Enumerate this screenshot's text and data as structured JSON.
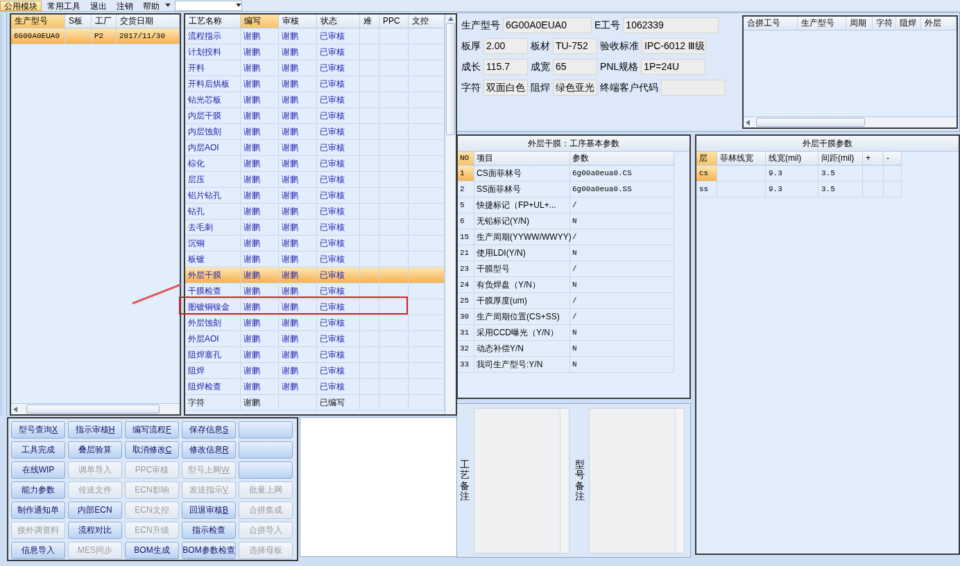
{
  "menu": [
    {
      "label": "公用模块",
      "selected": true
    },
    {
      "label": "常用工具",
      "selected": false
    },
    {
      "label": "退出",
      "selected": false
    },
    {
      "label": "注销",
      "selected": false
    },
    {
      "label": "帮助",
      "selected": false
    }
  ],
  "order_table": {
    "columns": [
      "生产型号",
      "S板",
      "工厂",
      "交货日期"
    ],
    "rows": [
      {
        "cells": [
          "6G00A0EUA0",
          "",
          "P2",
          "2017/11/30"
        ],
        "selected": true
      }
    ]
  },
  "process_table": {
    "columns": [
      {
        "label": "工艺名称",
        "selected": false
      },
      {
        "label": "编写",
        "selected": true
      },
      {
        "label": "审核",
        "selected": false
      },
      {
        "label": "状态",
        "selected": false
      },
      {
        "label": "难",
        "selected": false
      },
      {
        "label": "PPC",
        "selected": false
      },
      {
        "label": "文控",
        "selected": false
      }
    ],
    "rows": [
      {
        "cells": [
          "流程指示",
          "谢鹏",
          "谢鹏",
          "已审核"
        ],
        "kind": "reviewed",
        "selected": false
      },
      {
        "cells": [
          "计划投料",
          "谢鹏",
          "谢鹏",
          "已审核"
        ],
        "kind": "reviewed",
        "selected": false
      },
      {
        "cells": [
          "开料",
          "谢鹏",
          "谢鹏",
          "已审核"
        ],
        "kind": "reviewed",
        "selected": false
      },
      {
        "cells": [
          "开料后烘板",
          "谢鹏",
          "谢鹏",
          "已审核"
        ],
        "kind": "reviewed",
        "selected": false
      },
      {
        "cells": [
          "钻光芯板",
          "谢鹏",
          "谢鹏",
          "已审核"
        ],
        "kind": "reviewed",
        "selected": false
      },
      {
        "cells": [
          "内层干膜",
          "谢鹏",
          "谢鹏",
          "已审核"
        ],
        "kind": "reviewed",
        "selected": false
      },
      {
        "cells": [
          "内层蚀刻",
          "谢鹏",
          "谢鹏",
          "已审核"
        ],
        "kind": "reviewed",
        "selected": false
      },
      {
        "cells": [
          "内层AOI",
          "谢鹏",
          "谢鹏",
          "已审核"
        ],
        "kind": "reviewed",
        "selected": false
      },
      {
        "cells": [
          "棕化",
          "谢鹏",
          "谢鹏",
          "已审核"
        ],
        "kind": "reviewed",
        "selected": false
      },
      {
        "cells": [
          "层压",
          "谢鹏",
          "谢鹏",
          "已审核"
        ],
        "kind": "reviewed",
        "selected": false
      },
      {
        "cells": [
          "铝片钻孔",
          "谢鹏",
          "谢鹏",
          "已审核"
        ],
        "kind": "reviewed",
        "selected": false
      },
      {
        "cells": [
          "钻孔",
          "谢鹏",
          "谢鹏",
          "已审核"
        ],
        "kind": "reviewed",
        "selected": false
      },
      {
        "cells": [
          "去毛刺",
          "谢鹏",
          "谢鹏",
          "已审核"
        ],
        "kind": "reviewed",
        "selected": false
      },
      {
        "cells": [
          "沉铜",
          "谢鹏",
          "谢鹏",
          "已审核"
        ],
        "kind": "reviewed",
        "selected": false
      },
      {
        "cells": [
          "板镀",
          "谢鹏",
          "谢鹏",
          "已审核"
        ],
        "kind": "reviewed",
        "selected": false
      },
      {
        "cells": [
          "外层干膜",
          "谢鹏",
          "谢鹏",
          "已审核"
        ],
        "kind": "reviewed",
        "selected": true
      },
      {
        "cells": [
          "干膜检查",
          "谢鹏",
          "谢鹏",
          "已审核"
        ],
        "kind": "reviewed",
        "selected": false
      },
      {
        "cells": [
          "图镀铜镍金",
          "谢鹏",
          "谢鹏",
          "已审核"
        ],
        "kind": "reviewed",
        "selected": false
      },
      {
        "cells": [
          "外层蚀刻",
          "谢鹏",
          "谢鹏",
          "已审核"
        ],
        "kind": "reviewed",
        "selected": false
      },
      {
        "cells": [
          "外层AOI",
          "谢鹏",
          "谢鹏",
          "已审核"
        ],
        "kind": "reviewed",
        "selected": false
      },
      {
        "cells": [
          "阻焊塞孔",
          "谢鹏",
          "谢鹏",
          "已审核"
        ],
        "kind": "reviewed",
        "selected": false
      },
      {
        "cells": [
          "阻焊",
          "谢鹏",
          "谢鹏",
          "已审核"
        ],
        "kind": "reviewed",
        "selected": false
      },
      {
        "cells": [
          "阻焊检查",
          "谢鹏",
          "谢鹏",
          "已审核"
        ],
        "kind": "reviewed",
        "selected": false
      },
      {
        "cells": [
          "字符",
          "谢鹏",
          "",
          "已编写"
        ],
        "kind": "written",
        "selected": false
      }
    ]
  },
  "buttons": [
    {
      "label": "型号查询",
      "shortcut": "X",
      "disabled": false
    },
    {
      "label": "指示审核",
      "shortcut": "H",
      "disabled": false
    },
    {
      "label": "编写流程",
      "shortcut": "F",
      "disabled": false
    },
    {
      "label": "保存信息",
      "shortcut": "S",
      "disabled": false
    },
    {
      "disabled": false
    },
    {
      "label": "工具完成",
      "disabled": false
    },
    {
      "label": "叠层验算",
      "disabled": false
    },
    {
      "label": "取消修改",
      "shortcut": "C",
      "disabled": false
    },
    {
      "label": "修改信息",
      "shortcut": "R",
      "disabled": false
    },
    {
      "disabled": false
    },
    {
      "label": "在线WIP",
      "disabled": false
    },
    {
      "label": "调单导入",
      "disabled": true
    },
    {
      "label": "PPC审核",
      "disabled": true
    },
    {
      "label": "型号上网",
      "shortcut": "W",
      "disabled": true
    },
    {
      "disabled": false
    },
    {
      "label": "能力参数",
      "disabled": false
    },
    {
      "label": "传送文件",
      "disabled": true
    },
    {
      "label": "ECN影响",
      "disabled": true
    },
    {
      "label": "发送指示",
      "shortcut": "V",
      "disabled": true
    },
    {
      "label": "批量上网",
      "disabled": true
    },
    {
      "label": "制作通知单",
      "disabled": false
    },
    {
      "label": "内部ECN",
      "disabled": false
    },
    {
      "label": "ECN文控",
      "disabled": true
    },
    {
      "label": "回退审核",
      "shortcut": "B",
      "disabled": false
    },
    {
      "label": "合拼集成",
      "disabled": true
    },
    {
      "label": "接外调资料",
      "disabled": true
    },
    {
      "label": "流程对比",
      "disabled": false
    },
    {
      "label": "ECN升级",
      "disabled": true
    },
    {
      "label": "指示检查",
      "disabled": false
    },
    {
      "label": "合拼导入",
      "disabled": true
    },
    {
      "label": "信息导入",
      "disabled": false
    },
    {
      "label": "MES同步",
      "disabled": true
    },
    {
      "label": "BOM生成",
      "disabled": false
    },
    {
      "label": "BOM参数检查",
      "disabled": false
    },
    {
      "label": "选择母板",
      "disabled": true
    }
  ],
  "info_form": [
    [
      {
        "label": "生产型号",
        "value": "6G00A0EUA0"
      },
      {
        "label": "E工号",
        "value": "1062339"
      }
    ],
    [
      {
        "label": "板厚",
        "value": "2.00"
      },
      {
        "label": "板材",
        "value": "TU-752"
      },
      {
        "label": "验收标准",
        "value": "IPC-6012 Ⅲ级"
      }
    ],
    [
      {
        "label": "成长",
        "value": "115.7"
      },
      {
        "label": "成宽",
        "value": "65"
      },
      {
        "label": "PNL规格",
        "value": "1P=24U"
      }
    ],
    [
      {
        "label": "字符",
        "value": "双面白色"
      },
      {
        "label": "阻焊",
        "value": "绿色亚光"
      },
      {
        "label": "终端客户代码"
      }
    ]
  ],
  "merge_table": {
    "columns": [
      "合拼工号",
      "生产型号",
      "周期",
      "字符",
      "阻焊",
      "外层"
    ]
  },
  "process_params": {
    "title": "外层干膜：工序基本参数",
    "columns": [
      "NO",
      "项目",
      "参数"
    ],
    "rows": [
      {
        "cells": [
          "1",
          "CS面菲林号",
          "6g00a0eua0.CS"
        ],
        "selected": true
      },
      {
        "cells": [
          "2",
          "SS面菲林号",
          "6g00a0eua0.SS"
        ],
        "selected": false
      },
      {
        "cells": [
          "5",
          "快捷标记（FP+UL+...",
          "/"
        ],
        "selected": false
      },
      {
        "cells": [
          "6",
          "无铅标记(Y/N)",
          "N"
        ],
        "selected": false
      },
      {
        "cells": [
          "15",
          "生产周期(YYWW/WWYY)",
          "/"
        ],
        "selected": false
      },
      {
        "cells": [
          "21",
          "使用LDI(Y/N)",
          "N"
        ],
        "selected": false
      },
      {
        "cells": [
          "23",
          "干膜型号",
          "/"
        ],
        "selected": false
      },
      {
        "cells": [
          "24",
          "有负焊盘（Y/N）",
          "N"
        ],
        "selected": false
      },
      {
        "cells": [
          "25",
          "干膜厚度(um)",
          "/"
        ],
        "selected": false
      },
      {
        "cells": [
          "30",
          "生产周期位置(CS+SS)",
          "/"
        ],
        "selected": false
      },
      {
        "cells": [
          "31",
          "采用CCD曝光（Y/N）",
          "N"
        ],
        "selected": false
      },
      {
        "cells": [
          "32",
          "动态补偿Y/N",
          "N"
        ],
        "selected": false
      },
      {
        "cells": [
          "33",
          "我司生产型号:Y/N",
          "N"
        ],
        "selected": false
      }
    ]
  },
  "layer_params": {
    "title": "外层干膜参数",
    "columns": [
      "层",
      "菲林线宽",
      "线宽(mil)",
      "间距(mil)",
      "+",
      "-"
    ],
    "rows": [
      {
        "cells": [
          "cs",
          "",
          "9.3",
          "3.5",
          "",
          ""
        ],
        "selected": true
      },
      {
        "cells": [
          "ss",
          "",
          "9.3",
          "3.5",
          "",
          ""
        ],
        "selected": false
      }
    ]
  },
  "remarks": [
    {
      "label": "工艺备注"
    },
    {
      "label": "型号备注"
    }
  ]
}
